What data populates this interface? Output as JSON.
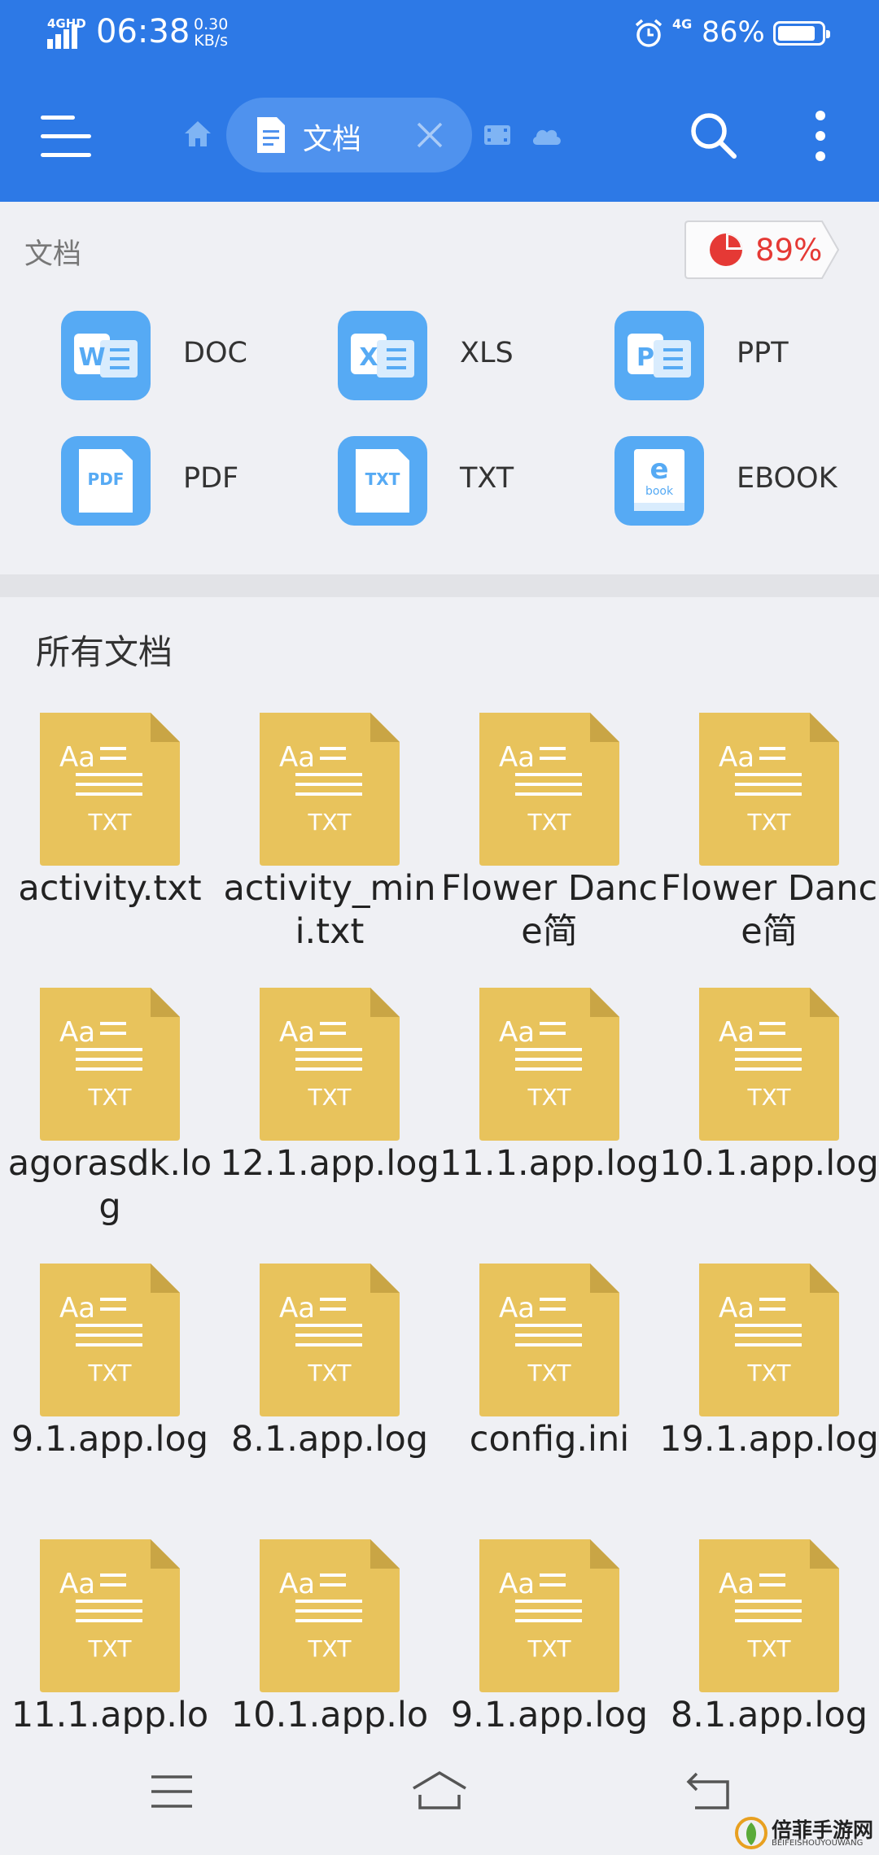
{
  "status_bar": {
    "network": "4GHD",
    "time": "06:38",
    "speed_value": "0.30",
    "speed_unit": "KB/s",
    "network2": "4G",
    "battery": "86%",
    "battery_level": 0.86
  },
  "toolbar": {
    "menu_icon": "hamburger-icon",
    "home_icon": "home-icon",
    "tab_label": "文档",
    "tab_icon": "document-icon",
    "close_icon": "close-icon",
    "extra_icons": [
      "film-icon",
      "cloud-icon"
    ],
    "search_icon": "search-icon",
    "more_icon": "more-vertical-icon"
  },
  "categories_section": {
    "title": "文档",
    "storage_percent": "89%",
    "storage_color": "#e53935",
    "items": [
      {
        "label": "DOC",
        "icon": "word-icon",
        "glyph": "W"
      },
      {
        "label": "XLS",
        "icon": "excel-icon",
        "glyph": "X"
      },
      {
        "label": "PPT",
        "icon": "powerpoint-icon",
        "glyph": "P"
      },
      {
        "label": "PDF",
        "icon": "pdf-icon",
        "glyph": "PDF"
      },
      {
        "label": "TXT",
        "icon": "txt-icon",
        "glyph": "TXT"
      },
      {
        "label": "EBOOK",
        "icon": "ebook-icon",
        "glyph": "e"
      }
    ]
  },
  "all_docs": {
    "title": "所有文档",
    "file_icon_label": "TXT",
    "file_icon_glyph": "Aa",
    "files": [
      "activity.txt",
      "activity_mini.txt",
      "Flower Dance简",
      "Flower Dance简",
      "agorasdk.log",
      "12.1.app.log",
      "11.1.app.log",
      "10.1.app.log",
      "9.1.app.log",
      "8.1.app.log",
      "config.ini",
      "19.1.app.log",
      "11.1.app.lo",
      "10.1.app.lo",
      "9.1.app.log",
      "8.1.app.log"
    ]
  },
  "nav_bar": {
    "icons": [
      "menu-icon",
      "home-icon",
      "back-icon"
    ]
  },
  "watermark": {
    "text": "倍菲手游网",
    "sub": "BEIFEISHOUYOUWANG"
  },
  "colors": {
    "accent": "#2d79e6",
    "category_icon": "#56aaf4",
    "file_icon": "#e8c35c"
  }
}
